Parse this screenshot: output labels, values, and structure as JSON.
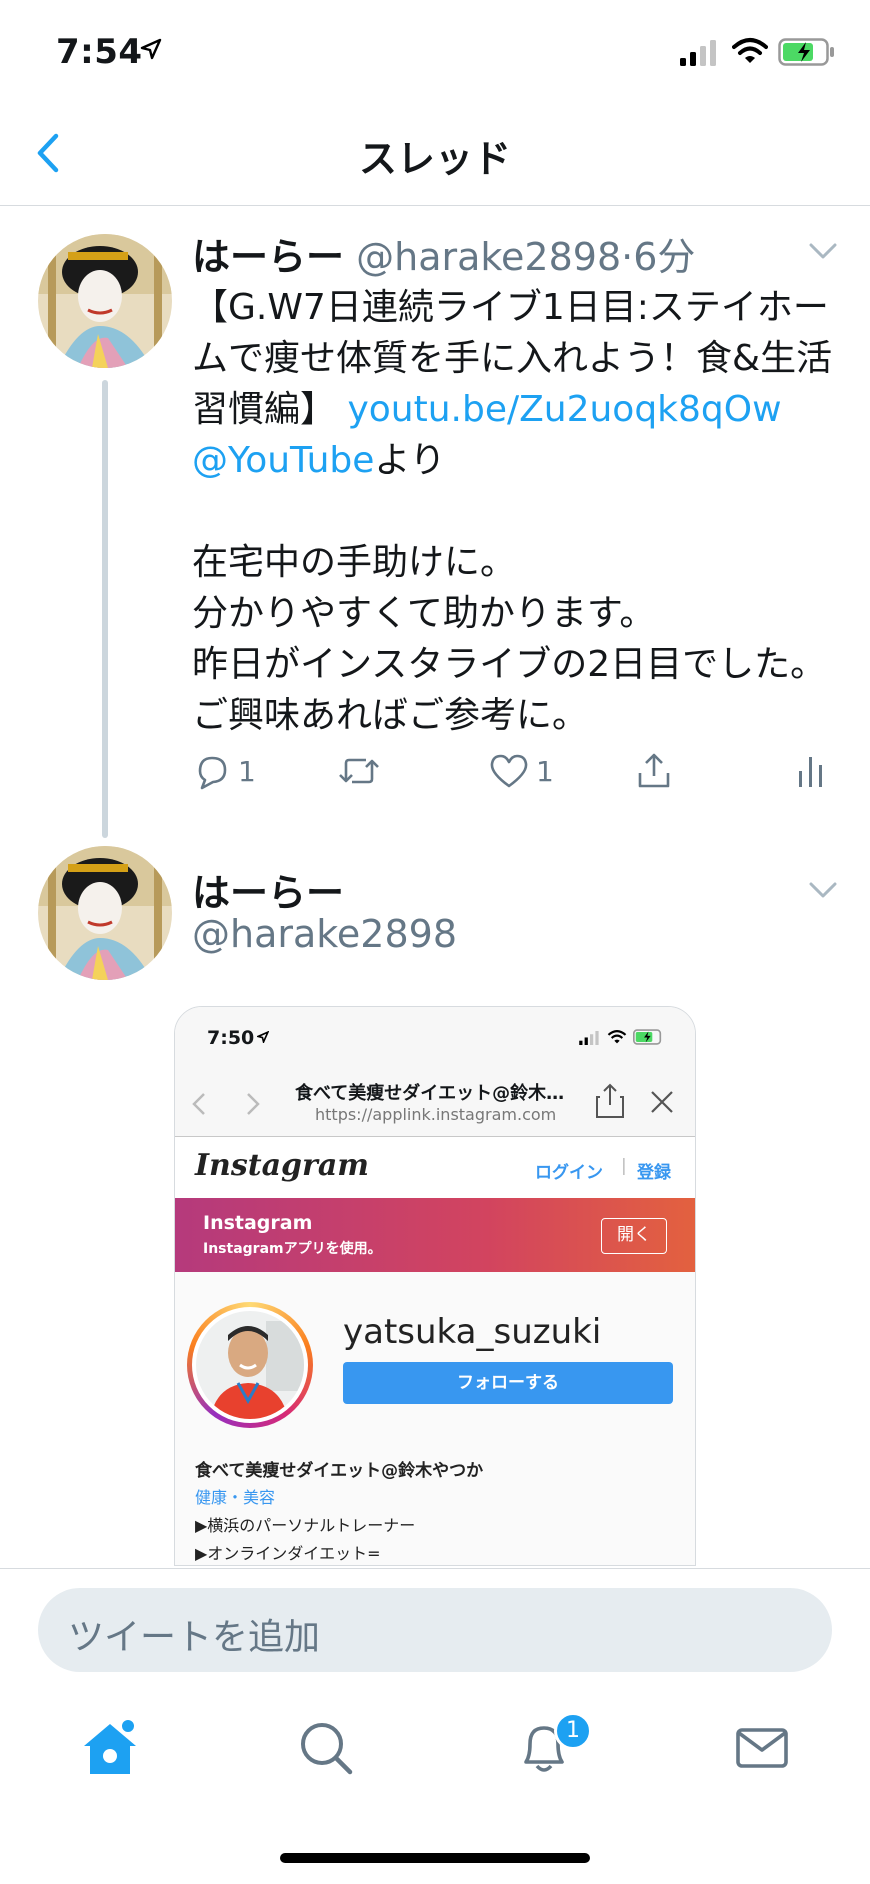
{
  "status_bar": {
    "time": "7:54"
  },
  "nav": {
    "title": "スレッド"
  },
  "tweet1": {
    "name": "はーらー",
    "handle": "@harake2898",
    "time_sep": "·",
    "time": "6分",
    "text_a": "【G.W7日連続ライブ1日目:ステイホームで痩せ体質を手に入れよう！食&生活習慣編】 ",
    "link": "youtu.be/Zu2uoqk8qOw",
    "mention": "@YouTube",
    "text_b": "より",
    "lines": [
      "在宅中の手助けに。",
      "分かりやすくて助かります。",
      "昨日がインスタライブの2日目でした。ご興味あればご参考に。"
    ],
    "reply_count": "1",
    "like_count": "1"
  },
  "tweet2": {
    "name": "はーらー",
    "handle": "@harake2898",
    "media": {
      "time": "7:50",
      "page_title": "食べて美痩せダイエット@鈴木…",
      "page_url": "https://applink.instagram.com",
      "logo": "Instagram",
      "login": "ログイン",
      "sep": "|",
      "signup": "登録",
      "banner_title": "Instagram",
      "banner_sub": "Instagramアプリを使用。",
      "open": "開く",
      "username": "yatsuka_suzuki",
      "follow": "フォローする",
      "bio_name": "食べて美痩せダイエット@鈴木やつか",
      "bio_category": "健康・美容",
      "bio_line1": "▶横浜のパーソナルトレーナー",
      "bio_line2": "▶オンラインダイエット="
    }
  },
  "compose": {
    "placeholder": "ツイートを追加"
  },
  "tabs": {
    "notifications_badge": "1"
  },
  "colors": {
    "accent": "#1da1f2",
    "muted": "#657786",
    "line": "#ccd6dd"
  }
}
